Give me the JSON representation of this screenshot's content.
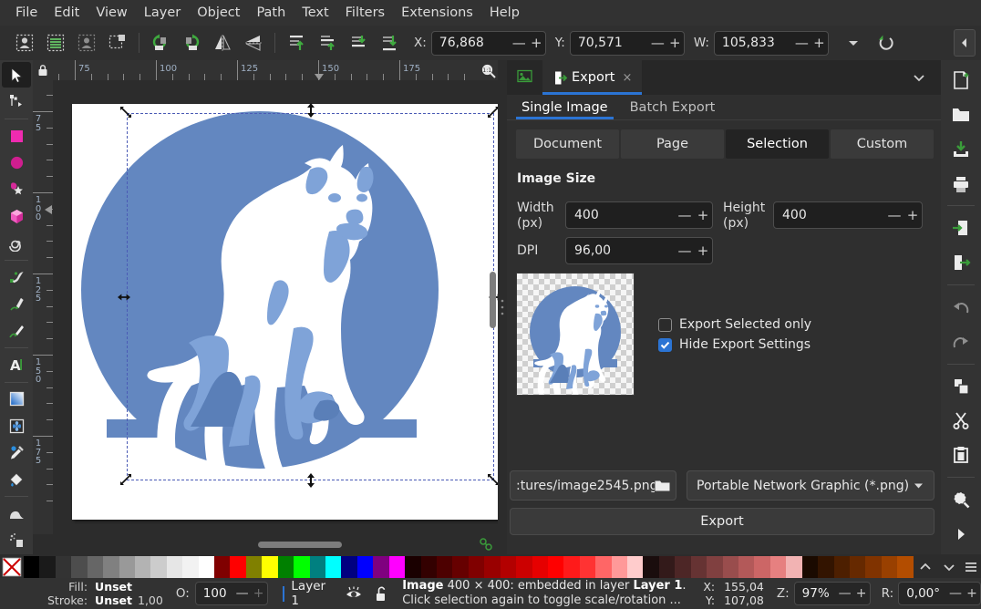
{
  "app": {
    "menu": [
      "File",
      "Edit",
      "View",
      "Layer",
      "Object",
      "Path",
      "Text",
      "Filters",
      "Extensions",
      "Help"
    ]
  },
  "toolbar": {
    "x_label": "X:",
    "x_value": "76,868",
    "y_label": "Y:",
    "y_value": "70,571",
    "w_label": "W:",
    "w_value": "105,833",
    "minus": "—",
    "plus": "+",
    "icons": [
      "select-all-icon",
      "select-all-layers-icon",
      "select-same-icon",
      "deselect-icon",
      "rotate-ccw-icon",
      "rotate-cw-icon",
      "flip-horizontal-icon",
      "flip-vertical-icon",
      "raise-to-top-icon",
      "raise-icon",
      "lower-icon",
      "lower-to-bottom-icon"
    ],
    "more_caret": "chevron-down-icon",
    "reset_icon": "reset-rotation-icon",
    "collapse_icon": "collapse-panel-icon"
  },
  "toolbox": {
    "tools": [
      {
        "name": "selector-tool",
        "active": true
      },
      {
        "name": "node-tool",
        "active": false
      },
      {
        "name": "rectangle-tool",
        "active": false
      },
      {
        "name": "ellipse-tool",
        "active": false
      },
      {
        "name": "star-tool",
        "active": false
      },
      {
        "name": "box3d-tool",
        "active": false
      },
      {
        "name": "spiral-tool",
        "active": false
      },
      {
        "name": "pen-tool",
        "active": false
      },
      {
        "name": "pencil-tool",
        "active": false
      },
      {
        "name": "calligraphy-tool",
        "active": false
      },
      {
        "name": "text-tool",
        "active": false
      },
      {
        "name": "gradient-tool",
        "active": false
      },
      {
        "name": "mesh-gradient-tool",
        "active": false
      },
      {
        "name": "dropper-tool",
        "active": false
      },
      {
        "name": "paint-bucket-tool",
        "active": false
      },
      {
        "name": "tweak-tool",
        "active": false
      },
      {
        "name": "spray-tool",
        "active": false
      }
    ]
  },
  "canvas": {
    "ruler_h_labels": [
      "75",
      "100",
      "125",
      "150",
      "175"
    ],
    "ruler_v_labels": [
      "75",
      "100",
      "125",
      "150",
      "175"
    ],
    "lock_icon": "ruler-lock-icon",
    "zoom_corner_icon": "zoom-1to1-icon",
    "snap_icon": "snap-toggle-icon",
    "artwork": {
      "name": "wolf-illustration",
      "circle_color": "#6387c0",
      "body_color": "#ffffff",
      "shade_color": "#7fa3d8",
      "shade_dark": "#5a7fb8"
    }
  },
  "export_panel": {
    "tabs": [
      {
        "label": "",
        "name": "image-properties-tab",
        "icon": "image-icon",
        "active": false
      },
      {
        "label": "Export",
        "name": "export-tab",
        "icon": "export-icon",
        "active": true,
        "close": "×"
      }
    ],
    "expand_icon": "chevron-down-icon",
    "subtabs": [
      {
        "label": "Single Image",
        "active": true
      },
      {
        "label": "Batch Export",
        "active": false
      }
    ],
    "segments": [
      {
        "label": "Document",
        "active": false
      },
      {
        "label": "Page",
        "active": false
      },
      {
        "label": "Selection",
        "active": true
      },
      {
        "label": "Custom",
        "active": false
      }
    ],
    "image_size_title": "Image Size",
    "width_label": "Width\n(px)",
    "width_label_l1": "Width",
    "width_label_l2": "(px)",
    "width_value": "400",
    "height_label_l1": "Height",
    "height_label_l2": "(px)",
    "height_value": "400",
    "dpi_label": "DPI",
    "dpi_value": "96,00",
    "minus": "—",
    "plus": "+",
    "checkbox_export_selected": {
      "label": "Export Selected only",
      "checked": false
    },
    "checkbox_hide_settings": {
      "label": "Hide Export Settings",
      "checked": true
    },
    "filename": ":tures/image2545.png",
    "filename_browse_icon": "folder-open-icon",
    "format": "Portable Network Graphic (*.png)",
    "format_caret": "chevron-down-icon",
    "export_button": "Export"
  },
  "icon_dock": {
    "items": [
      "new-document-icon",
      "open-document-icon",
      "save-document-icon",
      "print-icon",
      "import-icon",
      "export-icon",
      "undo-icon",
      "redo-icon",
      "duplicate-icon",
      "cut-icon",
      "paste-icon",
      "zoom-selection-icon",
      "expand-right-icon"
    ]
  },
  "palette": {
    "colors": [
      "#000000",
      "#1a1a1a",
      "#333333",
      "#4d4d4d",
      "#666666",
      "#808080",
      "#999999",
      "#b3b3b3",
      "#cccccc",
      "#e6e6e6",
      "#f2f2f2",
      "#ffffff",
      "#800000",
      "#ff0000",
      "#808000",
      "#ffff00",
      "#008000",
      "#00ff00",
      "#008080",
      "#00ffff",
      "#000080",
      "#0000ff",
      "#800080",
      "#ff00ff",
      "#1a0000",
      "#330000",
      "#4d0000",
      "#660000",
      "#800000",
      "#990000",
      "#b30000",
      "#cc0000",
      "#e60000",
      "#ff0000",
      "#ff1a1a",
      "#ff3333",
      "#ff6666",
      "#ff9999",
      "#ffcccc",
      "#1a0d0d",
      "#331a1a",
      "#4d2626",
      "#663333",
      "#804040",
      "#994d4d",
      "#b35959",
      "#cc6666",
      "#e68080",
      "#f2b3b3",
      "#1a0a00",
      "#331400",
      "#4d1f00",
      "#662900",
      "#803300",
      "#994000",
      "#b34d00"
    ],
    "scroll_up_icon": "chevron-up-icon",
    "scroll_down_icon": "chevron-down-icon",
    "menu_icon": "palette-menu-icon",
    "none_swatch": "none-swatch-x-icon"
  },
  "statusbar": {
    "fill_label": "Fill:",
    "fill_value": "Unset",
    "stroke_label": "Stroke:",
    "stroke_value": "Unset",
    "stroke_width": "1,00",
    "opacity_label": "O:",
    "opacity_value": "100",
    "minus": "—",
    "plus": "+",
    "layer_name": "Layer 1",
    "layer_visibility_icon": "eye-icon",
    "layer_lock_icon": "unlock-icon",
    "message_bold": "Image",
    "message_rest": " 400 × 400: embedded in layer ",
    "message_layer": "Layer 1",
    "message_end": ".",
    "message_line2": "Click selection again to toggle scale/rotation ...",
    "x_label": "X:",
    "x_value": "155,04",
    "y_label": "Y:",
    "y_value": "107,08",
    "z_label": "Z:",
    "zoom_value": "97%",
    "r_label": "R:",
    "rotation_value": "0,00°"
  }
}
